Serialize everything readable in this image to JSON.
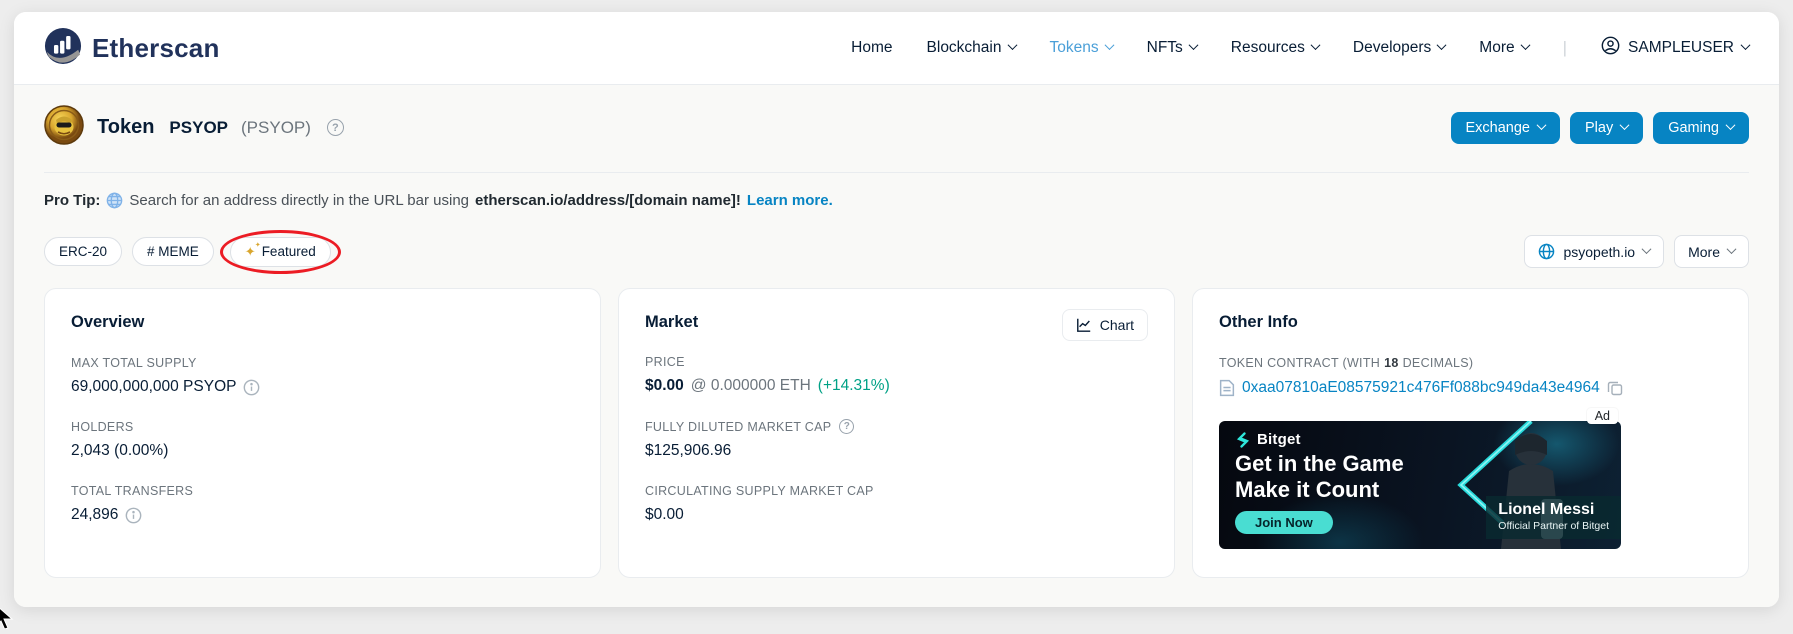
{
  "nav": {
    "brand": "Etherscan",
    "items": [
      {
        "label": "Home",
        "dropdown": false,
        "active": false
      },
      {
        "label": "Blockchain",
        "dropdown": true,
        "active": false
      },
      {
        "label": "Tokens",
        "dropdown": true,
        "active": true
      },
      {
        "label": "NFTs",
        "dropdown": true,
        "active": false
      },
      {
        "label": "Resources",
        "dropdown": true,
        "active": false
      },
      {
        "label": "Developers",
        "dropdown": true,
        "active": false
      },
      {
        "label": "More",
        "dropdown": true,
        "active": false
      }
    ],
    "user": "SAMPLEUSER"
  },
  "header": {
    "type_label": "Token",
    "name": "PSYOP",
    "symbol": "(PSYOP)",
    "buttons": [
      {
        "label": "Exchange"
      },
      {
        "label": "Play"
      },
      {
        "label": "Gaming"
      }
    ]
  },
  "protip": {
    "prefix": "Pro Tip:",
    "text_before": "Search for an address directly in the URL bar using",
    "highlight": "etherscan.io/address/[domain name]!",
    "link": "Learn more."
  },
  "tags": {
    "erc20": "ERC-20",
    "meme": "# MEME",
    "featured": "Featured"
  },
  "actions": {
    "website": "psyopeth.io",
    "more": "More"
  },
  "overview": {
    "title": "Overview",
    "max_total_supply_label": "MAX TOTAL SUPPLY",
    "max_total_supply_value": "69,000,000,000 PSYOP",
    "holders_label": "HOLDERS",
    "holders_value": "2,043 (0.00%)",
    "transfers_label": "TOTAL TRANSFERS",
    "transfers_value": "24,896"
  },
  "market": {
    "title": "Market",
    "chart_button": "Chart",
    "price_label": "PRICE",
    "price_usd": "$0.00",
    "price_eth": "@ 0.000000 ETH",
    "price_change": "(+14.31%)",
    "fdmc_label": "FULLY DILUTED MARKET CAP",
    "fdmc_value": "$125,906.96",
    "csmc_label": "CIRCULATING SUPPLY MARKET CAP",
    "csmc_value": "$0.00"
  },
  "other_info": {
    "title": "Other Info",
    "contract_label_pre": "TOKEN CONTRACT (WITH",
    "contract_decimals": "18",
    "contract_label_post": "DECIMALS)",
    "contract_address": "0xaa07810aE08575921c476Ff088bc949da43e4964",
    "ad": {
      "badge": "Ad",
      "brand": "Bitget",
      "headline1": "Get in the Game",
      "headline2": "Make it Count",
      "cta": "Join Now",
      "person": "Lionel Messi",
      "person_sub": "Official Partner of Bitget"
    }
  },
  "colors": {
    "accent": "#0784c3",
    "nav_active": "#4a9fd8",
    "success": "#00a186",
    "annotation_red": "#ec1c24",
    "sparkle_gold": "#d9a62e",
    "ad_teal": "#49ddd2",
    "brand_navy": "#21325b"
  }
}
